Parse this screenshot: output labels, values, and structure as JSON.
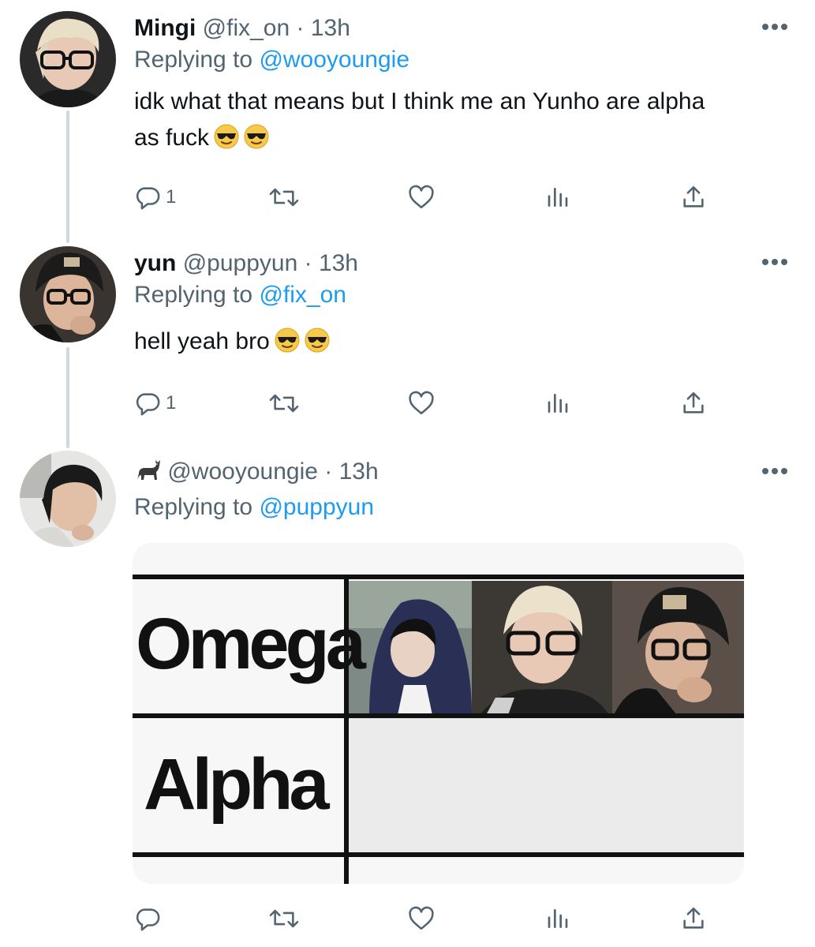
{
  "tweets": [
    {
      "name": "Mingi",
      "handle": "@fix_on",
      "dot": "·",
      "time": "13h",
      "replying_label": "Replying to",
      "replying_to": "@wooyoungie",
      "text_line1": "idk what that means but I think me an Yunho are alpha",
      "text_line2": "as fuck",
      "replies": "1"
    },
    {
      "name": "yun",
      "handle": "@puppyun",
      "dot": "·",
      "time": "13h",
      "replying_label": "Replying to",
      "replying_to": "@fix_on",
      "text": "hell yeah bro",
      "replies": "1"
    },
    {
      "name_icon": "cat-icon",
      "handle": "@wooyoungie",
      "dot": "·",
      "time": "13h",
      "replying_label": "Replying to",
      "replying_to": "@puppyun",
      "media": {
        "row1_label": "Omega",
        "row2_label": "Alpha"
      }
    }
  ],
  "icons": [
    "reply-icon",
    "retweet-icon",
    "like-icon",
    "analytics-icon",
    "share-icon",
    "more-icon",
    "sunglasses-emoji"
  ],
  "colors": {
    "link": "#1d9bf0",
    "secondary": "#536471",
    "text": "#0f1419",
    "thread_line": "#cfd9de"
  }
}
